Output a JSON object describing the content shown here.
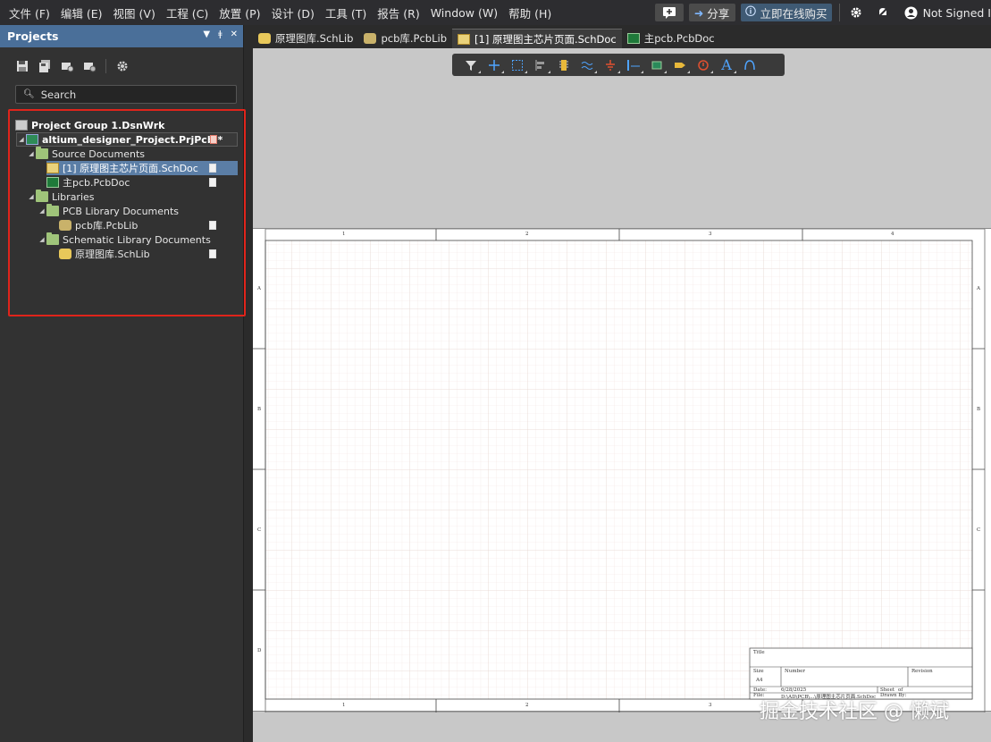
{
  "menubar": {
    "items": [
      "文件 (F)",
      "编辑 (E)",
      "视图 (V)",
      "工程 (C)",
      "放置 (P)",
      "设计 (D)",
      "工具 (T)",
      "报告 (R)",
      "Window (W)",
      "帮助 (H)"
    ],
    "share_label": "分享",
    "buy_label": "立即在线购买",
    "account_label": "Not Signed I"
  },
  "panel": {
    "title": "Projects",
    "search_placeholder": "Search"
  },
  "tree": {
    "group": "Project Group 1.DsnWrk",
    "project": "altium_designer_Project.PrjPcb *",
    "source_docs": "Source Documents",
    "sch_doc": "[1] 原理图主芯片页面.SchDoc",
    "pcb_doc": "主pcb.PcbDoc",
    "libraries": "Libraries",
    "pcb_lib_docs": "PCB Library Documents",
    "pcb_lib": "pcb库.PcbLib",
    "sch_lib_docs": "Schematic Library Documents",
    "sch_lib": "原理图库.SchLib"
  },
  "tabs": [
    {
      "label": "原理图库.SchLib",
      "active": false
    },
    {
      "label": "pcb库.PcbLib",
      "active": false
    },
    {
      "label": "[1] 原理图主芯片页面.SchDoc",
      "active": true
    },
    {
      "label": "主pcb.PcbDoc",
      "active": false
    }
  ],
  "sheet": {
    "col_labels": [
      "1",
      "2",
      "3",
      "4"
    ],
    "row_labels": [
      "A",
      "B",
      "C",
      "D"
    ],
    "title_block": {
      "title_label": "Title",
      "size_label": "Size",
      "size_value": "A4",
      "number_label": "Number",
      "revision_label": "Revision",
      "date_label": "Date:",
      "date_value": "6/28/2025",
      "sheet_label": "Sheet",
      "of_label": "of",
      "file_label": "File:",
      "file_value": "D:\\AD\\PCB\\...\\原理图主芯片页面.SchDoc",
      "drawn_label": "Drawn By:"
    }
  },
  "watermark": "掘金技术社区 @ 懒斌",
  "colors": {
    "panel_header": "#4a6f99",
    "highlight_box": "#e0241b",
    "tree_selected": "#5b7ea6",
    "folder": "#9fc47a",
    "grid": "#efe2dc"
  }
}
